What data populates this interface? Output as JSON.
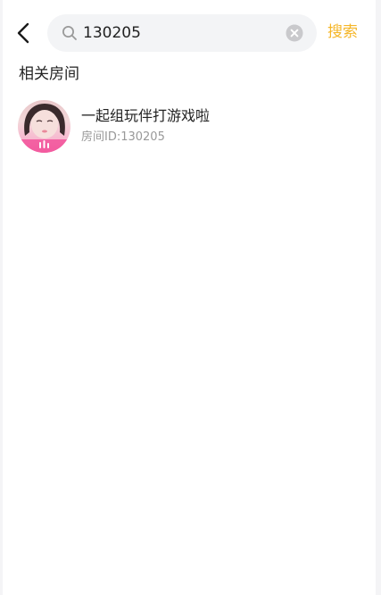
{
  "header": {
    "back_icon": "chevron-left-icon",
    "search": {
      "icon": "search-icon",
      "value": "130205",
      "placeholder": "",
      "clear_icon": "clear-circle-icon"
    },
    "submit_label": "搜索"
  },
  "section": {
    "title": "相关房间"
  },
  "rooms": [
    {
      "name": "一起组玩伴打游戏啦",
      "room_id": "房间ID:130205",
      "live_icon": "sound-bars-icon"
    }
  ],
  "colors": {
    "accent": "#f5b628",
    "primary_text": "#222222",
    "secondary_text": "#999999",
    "search_bg": "#f3f4f6",
    "avatar_badge": "#f2549b"
  }
}
